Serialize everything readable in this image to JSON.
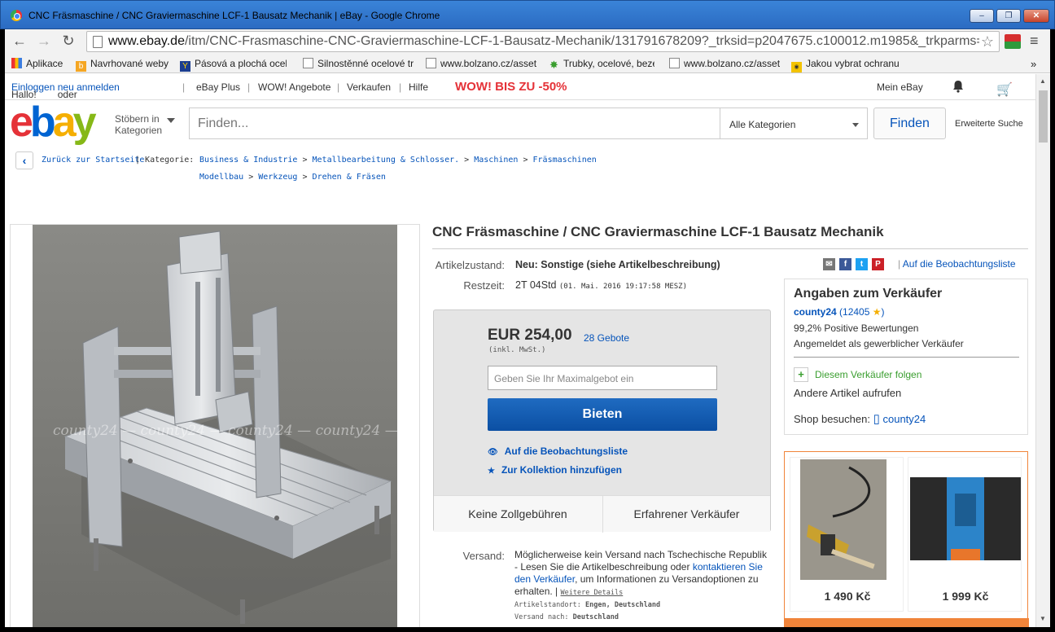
{
  "window": {
    "title": "CNC Fräsmaschine / CNC Graviermaschine LCF-1 Bausatz Mechanik | eBay - Google Chrome",
    "min": "–",
    "max": "❐",
    "close": "✕"
  },
  "browser": {
    "url_domain": "www.ebay.de",
    "url_path": "/itm/CNC-Frasmaschine-CNC-Graviermaschine-LCF-1-Bausatz-Mechanik/131791678209?_trksid=p2047675.c100012.m1985&_trkparms=aid",
    "bookmarks": [
      "Aplikace",
      "Navrhované weby",
      "Pásová a plochá ocel",
      "Silnostěnné ocelové tr",
      "www.bolzano.cz/asset",
      "Trubky, ocelové, beze",
      "www.bolzano.cz/asset",
      "Jakou vybrat ochranu"
    ],
    "more": "»"
  },
  "topnav": {
    "hello": "Hallo!",
    "login": "Einloggen",
    "or": "oder",
    "register": "neu anmelden",
    "ebay_plus": "eBay Plus",
    "wow_angebote": "WOW! Angebote",
    "verkaufen": "Verkaufen",
    "hilfe": "Hilfe",
    "promo": "WOW! BIS ZU -50%",
    "mein_ebay": "Mein eBay"
  },
  "header": {
    "logo": [
      "e",
      "b",
      "a",
      "y"
    ],
    "browse": "Stöbern in\nKategorien",
    "browse_l1": "Stöbern in",
    "browse_l2": "Kategorien",
    "search_placeholder": "Finden...",
    "category": "Alle Kategorien",
    "find": "Finden",
    "advanced": "Erweiterte Suche"
  },
  "breadcrumb": {
    "back": "Zurück zur Startseite",
    "kategorie": "Kategorie:",
    "row1": [
      "Business & Industrie",
      "Metallbearbeitung & Schlosser.",
      "Maschinen",
      "Fräsmaschinen"
    ],
    "row2": [
      "Modellbau",
      "Werkzeug",
      "Drehen & Fräsen"
    ],
    "sep": ">"
  },
  "item": {
    "title": "CNC Fräsmaschine / CNC Graviermaschine LCF-1 Bausatz Mechanik",
    "condition_label": "Artikelzustand:",
    "condition": "Neu: Sonstige (siehe Artikelbeschreibung)",
    "time_label": "Restzeit:",
    "time": "2T 04Std",
    "time_detail": "(01. Mai. 2016   19:17:58 MESZ)",
    "watermark": "county24 — county24 — county24 — county24 —"
  },
  "share": {
    "icons": [
      "email-icon",
      "facebook-icon",
      "twitter-icon",
      "pinterest-icon"
    ],
    "watch": "Auf die Beobachtungsliste"
  },
  "bid": {
    "price": "EUR 254,00",
    "bids": "28 Gebote",
    "vat": "(inkl. MwSt.)",
    "placeholder": "Geben Sie Ihr Maximalgebot ein",
    "button": "Bieten",
    "watch": "Auf die Beobachtungsliste",
    "collection": "Zur Kollektion hinzufügen",
    "feature1": "Keine Zollgebühren",
    "feature2": "Erfahrener Verkäufer"
  },
  "shipping": {
    "label": "Versand:",
    "text1": "Möglicherweise kein Versand nach Tschechische Republik - Lesen Sie die Artikelbeschreibung oder",
    "contact": "kontaktieren Sie den Verkäufer",
    "text2": ", um Informationen zu Versandoptionen zu erhalten. |",
    "details": "Weitere Details",
    "location_label": "Artikelstandort:",
    "location": "Engen, Deutschland",
    "to_label": "Versand nach:",
    "to": "Deutschland"
  },
  "seller": {
    "heading": "Angaben zum Verkäufer",
    "name": "county24",
    "rating_open": "(",
    "rating": "12405",
    "rating_close": ")",
    "positive": "99,2% Positive Bewertungen",
    "type": "Angemeldet als gewerblicher Verkäufer",
    "follow": "Diesem Verkäufer folgen",
    "other": "Andere Artikel aufrufen",
    "shop_label": "Shop besuchen:",
    "shop": "county24"
  },
  "related": [
    {
      "price": "1 490 Kč"
    },
    {
      "price": "1 999 Kč"
    }
  ],
  "colors": {
    "ebay_red": "#e53238",
    "ebay_blue": "#0064d2",
    "ebay_yellow": "#f5af02",
    "ebay_green": "#86b817",
    "link": "#0654ba",
    "bid_button": "#0b4fa3",
    "orange": "#f0843a"
  }
}
